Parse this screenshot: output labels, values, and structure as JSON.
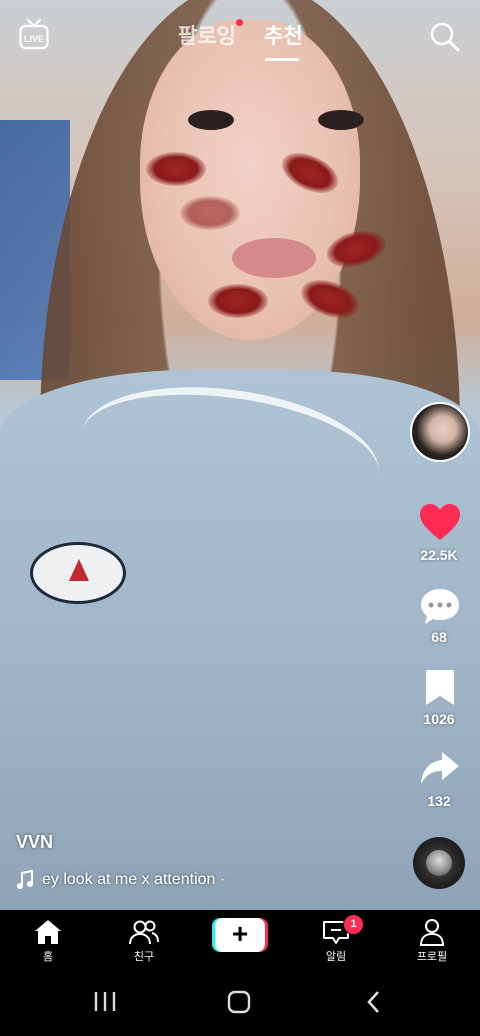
{
  "top_tabs": {
    "following": "팔로잉",
    "for_you": "추천"
  },
  "live_label": "LIVE",
  "side": {
    "likes": "22.5K",
    "comments": "68",
    "saves": "1026",
    "shares": "132"
  },
  "video": {
    "author": "VVN",
    "music": "ey look at me x attention ·"
  },
  "nav": {
    "home": "홈",
    "friends": "친구",
    "create": "+",
    "inbox": "알림",
    "inbox_badge": "1",
    "profile": "프로필"
  },
  "colors": {
    "accent_red": "#fe2c55",
    "accent_cyan": "#25f4ee"
  }
}
